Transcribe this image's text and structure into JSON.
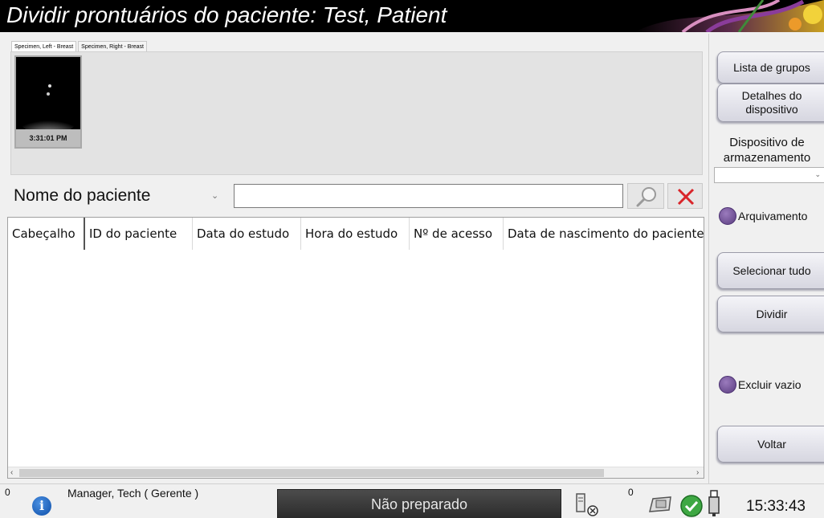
{
  "window": {
    "title": "Dividir prontuários do paciente: Test, Patient"
  },
  "tabs": [
    "Specimen, Left - Breast",
    "Specimen, Right - Breast"
  ],
  "thumbnail": {
    "time": "3:31:01 PM"
  },
  "search": {
    "field_label": "Nome do paciente",
    "value": "",
    "placeholder": ""
  },
  "table": {
    "columns": [
      "Cabeçalho",
      "ID do paciente",
      "Data do estudo",
      "Hora do estudo",
      "Nº de acesso",
      "Data de nascimento do paciente"
    ],
    "rows": []
  },
  "sidebar": {
    "group_list": "Lista de grupos",
    "device_details": "Detalhes do dispositivo",
    "storage_label": "Dispositivo de armazenamento",
    "storage_value": "",
    "archive_label": "Arquivamento",
    "select_all": "Selecionar tudo",
    "split": "Dividir",
    "delete_empty": "Excluir vazio",
    "back": "Voltar"
  },
  "status": {
    "alert_count": "0",
    "user": "Manager, Tech ( Gerente )",
    "state": "Não preparado",
    "queue_count": "0",
    "time": "15:33:43"
  },
  "colors": {
    "titlebar_bg": "#000000",
    "radio": "#6a4b90",
    "clear_x": "#d9252a",
    "status_ok": "#3ea843"
  }
}
